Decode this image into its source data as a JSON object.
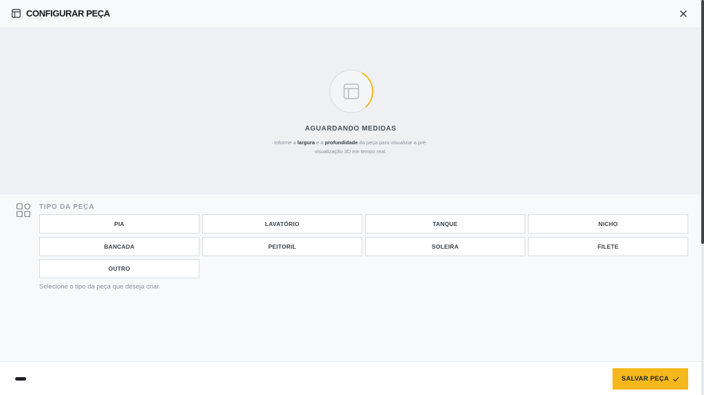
{
  "header": {
    "title": "CONFIGURAR PEÇA",
    "title_icon": "layout-icon",
    "close_icon": "close-icon"
  },
  "preview": {
    "status": "AGUARDANDO MEDIDAS",
    "desc_prefix": "Informe a ",
    "desc_bold1": "largura",
    "desc_mid": " e a ",
    "desc_bold2": "profundidade",
    "desc_suffix": " da peça para visualizar a pré-visualização 3D em tempo real.",
    "spinner_icon": "layout-icon",
    "accent": "#f4b81c"
  },
  "section": {
    "title": "TIPO DA PEÇA",
    "icon": "grid-icon",
    "options": [
      "PIA",
      "LAVATÓRIO",
      "TANQUE",
      "NICHO",
      "BANCADA",
      "PEITORIL",
      "SOLEIRA",
      "FILETE",
      "OUTRO"
    ],
    "hint": "Selecione o tipo da peça que deseja criar."
  },
  "footer": {
    "save_label": "SALVAR PEÇA",
    "save_icon": "check-icon",
    "save_color": "#f4b81c"
  }
}
